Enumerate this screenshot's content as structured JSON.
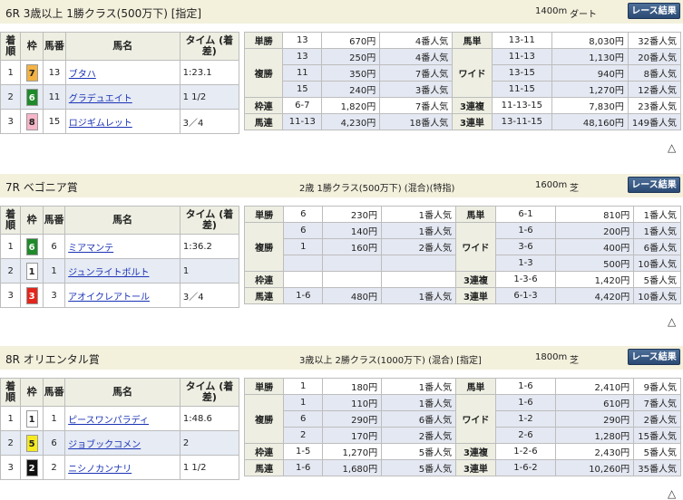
{
  "races": [
    {
      "title": "6R 3歳以上 1勝クラス(500万下) [指定]",
      "conditions": "",
      "distance": "1400m",
      "surface": "ダート",
      "button": "レース結果",
      "columns": [
        "着順",
        "枠",
        "馬番",
        "馬名",
        "タイム (着差)"
      ],
      "rows": [
        {
          "pos": "1",
          "waku": "7",
          "waku_bg": "#f3b243",
          "waku_fg": "#222",
          "num": "13",
          "horse": "ブタハ",
          "time": "1:23.1"
        },
        {
          "pos": "2",
          "waku": "6",
          "waku_bg": "#1f8a2a",
          "waku_fg": "#fff",
          "num": "11",
          "horse": "グラデュエイト",
          "time": "1 1/2"
        },
        {
          "pos": "3",
          "waku": "8",
          "waku_bg": "#f7b6c8",
          "waku_fg": "#222",
          "num": "15",
          "horse": "ロジギムレット",
          "time": "3／4"
        }
      ],
      "payouts": [
        {
          "l": "単勝",
          "c1": [
            "13"
          ],
          "p1": [
            "670円"
          ],
          "r1": [
            "4番人気"
          ],
          "l2": "馬単",
          "c2": [
            "13-11"
          ],
          "p2": [
            "8,030円"
          ],
          "r2": [
            "32番人気"
          ]
        },
        {
          "l": "複勝",
          "c1": [
            "13",
            "11",
            "15"
          ],
          "p1": [
            "250円",
            "350円",
            "240円"
          ],
          "r1": [
            "4番人気",
            "7番人気",
            "3番人気"
          ],
          "l2": "ワイド",
          "c2": [
            "11-13",
            "13-15",
            "11-15"
          ],
          "p2": [
            "1,130円",
            "940円",
            "1,270円"
          ],
          "r2": [
            "20番人気",
            "8番人気",
            "12番人気"
          ]
        },
        {
          "l": "枠連",
          "c1": [
            "6-7"
          ],
          "p1": [
            "1,820円"
          ],
          "r1": [
            "7番人気"
          ],
          "l2": "3連複",
          "c2": [
            "11-13-15"
          ],
          "p2": [
            "7,830円"
          ],
          "r2": [
            "23番人気"
          ]
        },
        {
          "l": "馬連",
          "c1": [
            "11-13"
          ],
          "p1": [
            "4,230円"
          ],
          "r1": [
            "18番人気"
          ],
          "l2": "3連単",
          "c2": [
            "13-11-15"
          ],
          "p2": [
            "48,160円"
          ],
          "r2": [
            "149番人気"
          ]
        }
      ]
    },
    {
      "title": "7R ベゴニア賞",
      "conditions": "2歳 1勝クラス(500万下) (混合)(特指)",
      "distance": "1600m",
      "surface": "芝",
      "button": "レース結果",
      "columns": [
        "着順",
        "枠",
        "馬番",
        "馬名",
        "タイム (着差)"
      ],
      "rows": [
        {
          "pos": "1",
          "waku": "6",
          "waku_bg": "#1f8a2a",
          "waku_fg": "#fff",
          "num": "6",
          "horse": "ミアマンテ",
          "time": "1:36.2"
        },
        {
          "pos": "2",
          "waku": "1",
          "waku_bg": "#ffffff",
          "waku_fg": "#222",
          "num": "1",
          "horse": "ジュンライトボルト",
          "time": "1"
        },
        {
          "pos": "3",
          "waku": "3",
          "waku_bg": "#e3261c",
          "waku_fg": "#fff",
          "num": "3",
          "horse": "アオイクレアトール",
          "time": "3／4"
        }
      ],
      "payouts": [
        {
          "l": "単勝",
          "c1": [
            "6"
          ],
          "p1": [
            "230円"
          ],
          "r1": [
            "1番人気"
          ],
          "l2": "馬単",
          "c2": [
            "6-1"
          ],
          "p2": [
            "810円"
          ],
          "r2": [
            "1番人気"
          ]
        },
        {
          "l": "複勝",
          "c1": [
            "6",
            "1"
          ],
          "p1": [
            "140円",
            "160円"
          ],
          "r1": [
            "1番人気",
            "2番人気"
          ],
          "l2": "ワイド",
          "c2": [
            "1-6",
            "3-6",
            "1-3"
          ],
          "p2": [
            "200円",
            "400円",
            "500円"
          ],
          "r2": [
            "1番人気",
            "6番人気",
            "10番人気"
          ]
        },
        {
          "l": "枠連",
          "c1": [
            ""
          ],
          "p1": [
            ""
          ],
          "r1": [
            ""
          ],
          "l2": "3連複",
          "c2": [
            "1-3-6"
          ],
          "p2": [
            "1,420円"
          ],
          "r2": [
            "5番人気"
          ]
        },
        {
          "l": "馬連",
          "c1": [
            "1-6"
          ],
          "p1": [
            "480円"
          ],
          "r1": [
            "1番人気"
          ],
          "l2": "3連単",
          "c2": [
            "6-1-3"
          ],
          "p2": [
            "4,420円"
          ],
          "r2": [
            "10番人気"
          ]
        }
      ]
    },
    {
      "title": "8R オリエンタル賞",
      "conditions": "3歳以上 2勝クラス(1000万下) (混合) [指定]",
      "distance": "1800m",
      "surface": "芝",
      "button": "レース結果",
      "columns": [
        "着順",
        "枠",
        "馬番",
        "馬名",
        "タイム (着差)"
      ],
      "rows": [
        {
          "pos": "1",
          "waku": "1",
          "waku_bg": "#ffffff",
          "waku_fg": "#222",
          "num": "1",
          "horse": "ピースワンパラディ",
          "time": "1:48.6"
        },
        {
          "pos": "2",
          "waku": "5",
          "waku_bg": "#f6ea1f",
          "waku_fg": "#222",
          "num": "6",
          "horse": "ジョブックコメン",
          "time": "2"
        },
        {
          "pos": "3",
          "waku": "2",
          "waku_bg": "#111111",
          "waku_fg": "#fff",
          "num": "2",
          "horse": "ニシノカンナリ",
          "time": "1 1/2"
        }
      ],
      "payouts": [
        {
          "l": "単勝",
          "c1": [
            "1"
          ],
          "p1": [
            "180円"
          ],
          "r1": [
            "1番人気"
          ],
          "l2": "馬単",
          "c2": [
            "1-6"
          ],
          "p2": [
            "2,410円"
          ],
          "r2": [
            "9番人気"
          ]
        },
        {
          "l": "複勝",
          "c1": [
            "1",
            "6",
            "2"
          ],
          "p1": [
            "110円",
            "290円",
            "170円"
          ],
          "r1": [
            "1番人気",
            "6番人気",
            "2番人気"
          ],
          "l2": "ワイド",
          "c2": [
            "1-6",
            "1-2",
            "2-6"
          ],
          "p2": [
            "610円",
            "290円",
            "1,280円"
          ],
          "r2": [
            "7番人気",
            "2番人気",
            "15番人気"
          ]
        },
        {
          "l": "枠連",
          "c1": [
            "1-5"
          ],
          "p1": [
            "1,270円"
          ],
          "r1": [
            "5番人気"
          ],
          "l2": "3連複",
          "c2": [
            "1-2-6"
          ],
          "p2": [
            "2,430円"
          ],
          "r2": [
            "5番人気"
          ]
        },
        {
          "l": "馬連",
          "c1": [
            "1-6"
          ],
          "p1": [
            "1,680円"
          ],
          "r1": [
            "5番人気"
          ],
          "l2": "3連単",
          "c2": [
            "1-6-2"
          ],
          "p2": [
            "10,260円"
          ],
          "r2": [
            "35番人気"
          ]
        }
      ]
    }
  ],
  "icons": {
    "up": "up-arrow-icon"
  },
  "up_glyph": "△"
}
